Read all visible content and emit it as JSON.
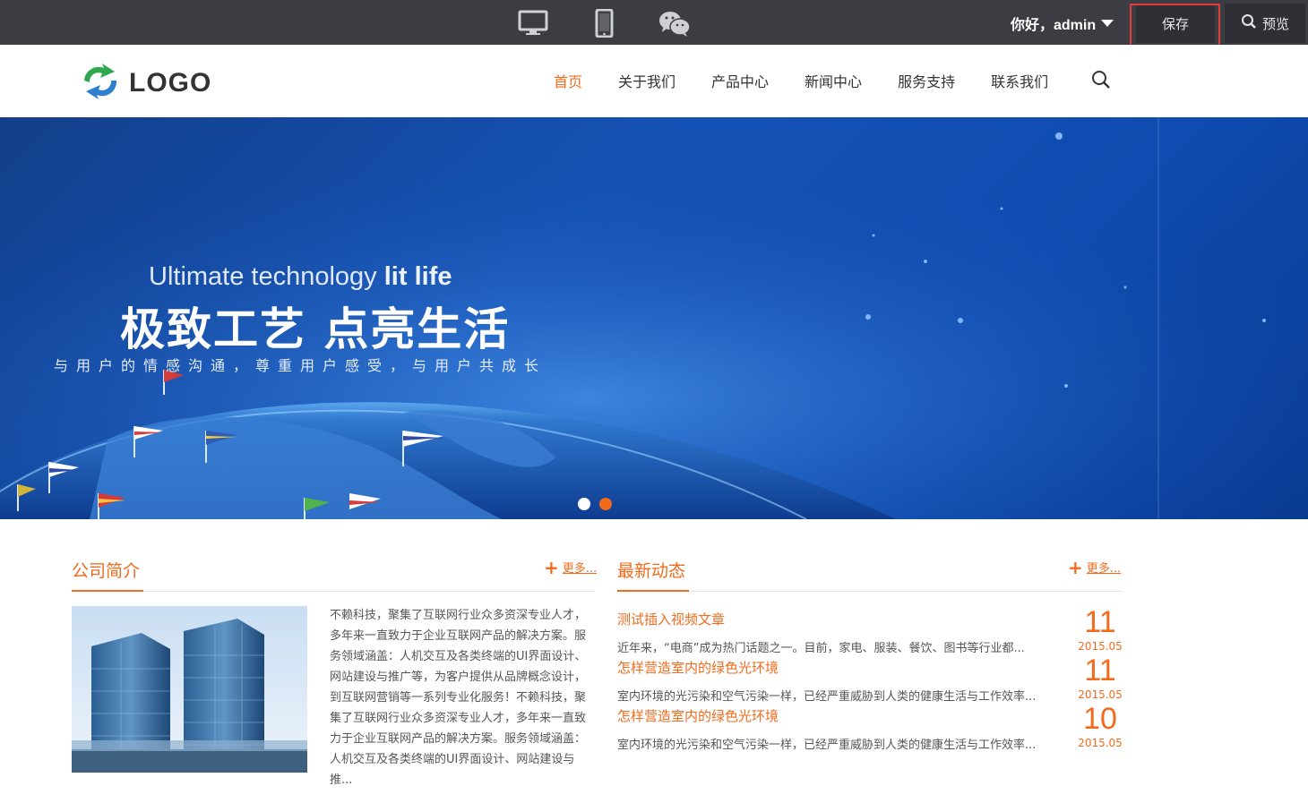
{
  "adminbar": {
    "devices": [
      "desktop-icon",
      "mobile-icon",
      "wechat-icon"
    ],
    "greeting": "你好，admin",
    "save_label": "保存",
    "preview_label": "预览"
  },
  "header": {
    "logo_text": "LOGO",
    "nav": [
      "首页",
      "关于我们",
      "产品中心",
      "新闻中心",
      "服务支持",
      "联系我们"
    ],
    "active_nav": "首页"
  },
  "banner": {
    "en_light": "Ultimate technology ",
    "en_bold": "lit life",
    "cn_title": "极致工艺 点亮生活",
    "subtitle": "与用户的情感沟通，尊重用户感受，与用户共成长",
    "slides": 2,
    "active_slide": 2
  },
  "about": {
    "title": "公司简介",
    "more": "更多...",
    "text": "不赖科技，聚集了互联网行业众多资深专业人才，多年来一直致力于企业互联网产品的解决方案。服务领域涵盖：人机交互及各类终端的UI界面设计、网站建设与推广等，为客户提供从品牌概念设计，到互联网营销等一系列专业化服务！不赖科技，聚集了互联网行业众多资深专业人才，多年来一直致力于企业互联网产品的解决方案。服务领域涵盖：人机交互及各类终端的UI界面设计、网站建设与推..."
  },
  "news": {
    "title": "最新动态",
    "more": "更多...",
    "items": [
      {
        "title": "测试插入视频文章",
        "desc": "近年来，“电商”成为热门话题之一。目前，家电、服装、餐饮、图书等行业都...",
        "day": "11",
        "month": "2015.05"
      },
      {
        "title": "怎样营造室内的绿色光环境",
        "desc": "室内环境的光污染和空气污染一样，已经严重威胁到人类的健康生活与工作效率...",
        "day": "11",
        "month": "2015.05"
      },
      {
        "title": "怎样营造室内的绿色光环境",
        "desc": "室内环境的光污染和空气污染一样，已经严重威胁到人类的健康生活与工作效率...",
        "day": "10",
        "month": "2015.05"
      }
    ]
  },
  "colors": {
    "accent": "#f26b1d",
    "adminbar": "#3c3d42",
    "highlight": "#e03c3c"
  }
}
